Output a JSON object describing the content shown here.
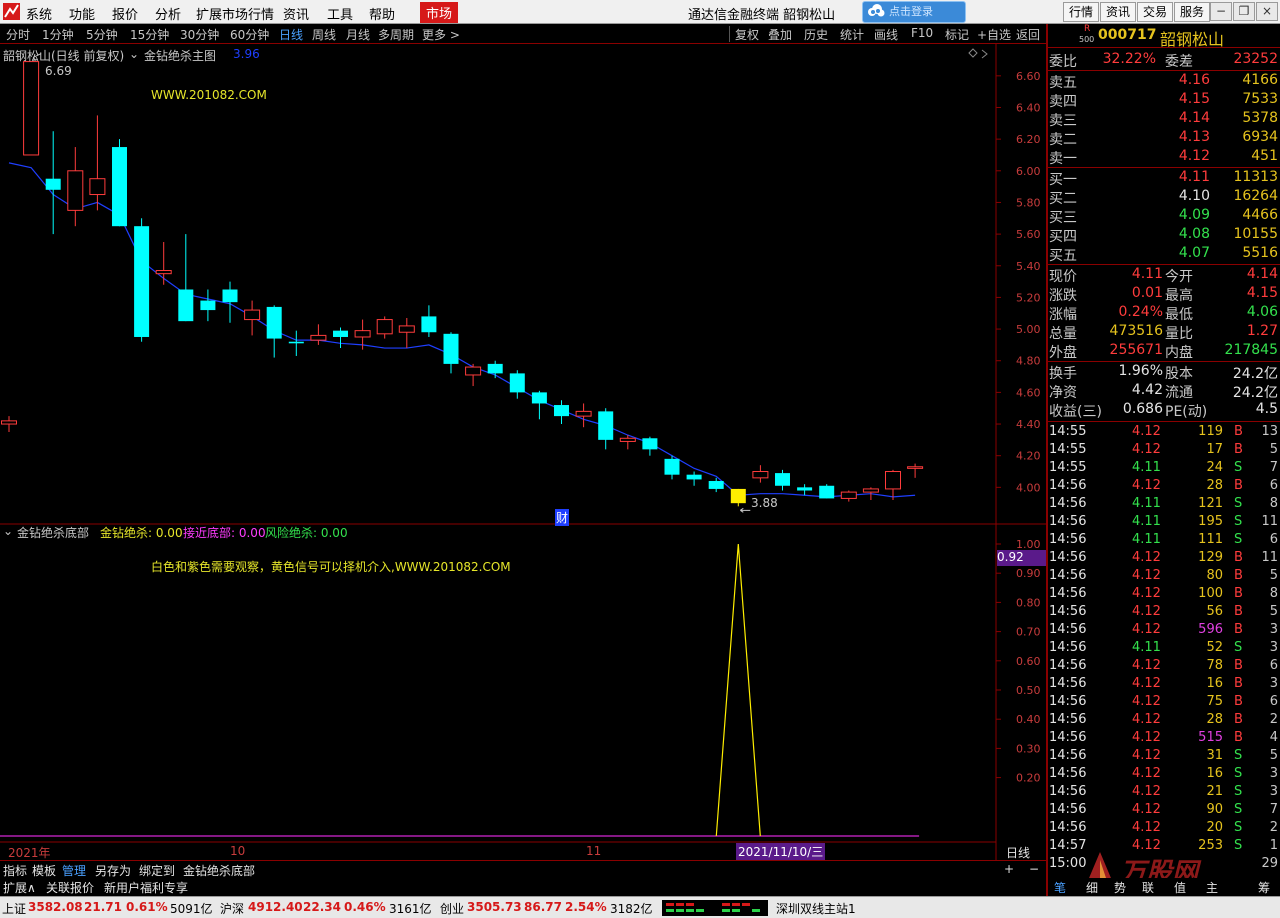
{
  "menubar": {
    "items": [
      "系统",
      "功能",
      "报价",
      "分析",
      "扩展市场行情",
      "资讯",
      "工具",
      "帮助"
    ],
    "market": "市场",
    "title": "通达信金融终端  韶钢松山",
    "login": "点击登录",
    "right_buttons": [
      "行情",
      "资讯",
      "交易",
      "服务"
    ]
  },
  "toolbar": {
    "periods": [
      "分时",
      "1分钟",
      "5分钟",
      "15分钟",
      "30分钟",
      "60分钟",
      "日线",
      "周线",
      "月线",
      "多周期",
      "更多 >"
    ],
    "active": "日线",
    "right": [
      "复权",
      "叠加",
      "历史",
      "统计",
      "画线",
      "F10",
      "标记",
      "+自选",
      "返回"
    ]
  },
  "main_chart": {
    "caption": "韶钢松山(日线 前复权)",
    "indicator": "金钻绝杀主图",
    "indicator_value": "3.96",
    "watermark": "WWW.201082.COM",
    "high_mark": "6.69",
    "low_mark": "3.88",
    "fin_marker": "财",
    "y_labels": [
      "6.60",
      "6.40",
      "6.20",
      "6.00",
      "5.80",
      "5.60",
      "5.40",
      "5.20",
      "5.00",
      "4.80",
      "4.60",
      "4.40",
      "4.20",
      "4.00"
    ],
    "colors": {
      "up": "#ff3c3c",
      "down": "#00ffff",
      "ma": "#1f3fff",
      "signal": "#ffee00"
    }
  },
  "chart_data": {
    "type": "candlestick",
    "ylim": [
      3.8,
      6.7
    ],
    "ohlc": [
      [
        4.4,
        4.45,
        4.35,
        4.42
      ],
      [
        6.1,
        6.69,
        6.2,
        6.69
      ],
      [
        5.95,
        6.25,
        5.6,
        5.88
      ],
      [
        5.75,
        6.15,
        5.65,
        6.0
      ],
      [
        5.85,
        6.35,
        5.75,
        5.95
      ],
      [
        6.15,
        6.2,
        5.65,
        5.65
      ],
      [
        5.65,
        5.7,
        4.92,
        4.95
      ],
      [
        5.35,
        5.55,
        5.28,
        5.37
      ],
      [
        5.25,
        5.6,
        5.05,
        5.05
      ],
      [
        5.18,
        5.25,
        5.05,
        5.12
      ],
      [
        5.25,
        5.3,
        5.04,
        5.17
      ],
      [
        5.06,
        5.18,
        4.96,
        5.12
      ],
      [
        5.14,
        5.15,
        4.82,
        4.94
      ],
      [
        4.92,
        4.99,
        4.83,
        4.91
      ],
      [
        4.93,
        5.03,
        4.9,
        4.96
      ],
      [
        4.99,
        5.01,
        4.88,
        4.95
      ],
      [
        4.95,
        5.06,
        4.87,
        4.99
      ],
      [
        4.97,
        5.08,
        4.94,
        5.06
      ],
      [
        4.98,
        5.07,
        4.88,
        5.02
      ],
      [
        5.08,
        5.15,
        4.95,
        4.98
      ],
      [
        4.97,
        4.98,
        4.72,
        4.78
      ],
      [
        4.71,
        4.78,
        4.64,
        4.76
      ],
      [
        4.78,
        4.8,
        4.69,
        4.72
      ],
      [
        4.72,
        4.74,
        4.56,
        4.6
      ],
      [
        4.6,
        4.61,
        4.43,
        4.53
      ],
      [
        4.52,
        4.55,
        4.4,
        4.45
      ],
      [
        4.45,
        4.53,
        4.38,
        4.48
      ],
      [
        4.48,
        4.5,
        4.24,
        4.3
      ],
      [
        4.29,
        4.33,
        4.24,
        4.31
      ],
      [
        4.31,
        4.32,
        4.2,
        4.24
      ],
      [
        4.18,
        4.2,
        4.05,
        4.08
      ],
      [
        4.08,
        4.1,
        4.01,
        4.05
      ],
      [
        4.04,
        4.06,
        3.97,
        3.99
      ],
      [
        3.9,
        3.99,
        3.88,
        3.99
      ],
      [
        4.06,
        4.14,
        4.03,
        4.1
      ],
      [
        4.09,
        4.11,
        3.98,
        4.01
      ],
      [
        4.0,
        4.02,
        3.95,
        3.98
      ],
      [
        4.01,
        4.02,
        3.93,
        3.93
      ],
      [
        3.93,
        3.98,
        3.91,
        3.97
      ],
      [
        3.97,
        4.0,
        3.92,
        3.99
      ],
      [
        3.99,
        4.11,
        3.92,
        4.1
      ],
      [
        4.12,
        4.15,
        4.06,
        4.13
      ]
    ],
    "ma": [
      6.05,
      6.02,
      5.85,
      5.76,
      5.8,
      5.72,
      5.43,
      5.32,
      5.22,
      5.19,
      5.16,
      5.08,
      4.99,
      4.93,
      4.93,
      4.91,
      4.9,
      4.88,
      4.88,
      4.9,
      4.84,
      4.76,
      4.71,
      4.63,
      4.55,
      4.49,
      4.43,
      4.39,
      4.33,
      4.28,
      4.2,
      4.12,
      4.07,
      3.95,
      3.96,
      3.96,
      3.95,
      3.94,
      3.95,
      3.96,
      3.94,
      3.95
    ]
  },
  "sub_chart": {
    "caption": "金钻绝杀底部",
    "v1_label": "金钻绝杀: 0.00",
    "v2_label": "接近底部: 0.00",
    "v3_label": "风险绝杀: 0.00",
    "note": "白色和紫色需要观察，黄色信号可以择机介入,WWW.201082.COM",
    "y_labels": [
      "1.00",
      "0.90",
      "0.80",
      "0.70",
      "0.60",
      "0.50",
      "0.40",
      "0.30",
      "0.20"
    ],
    "current": "0.92",
    "signal_value": 1.0
  },
  "x_axis": {
    "labels": [
      "2021年",
      "10",
      "11"
    ],
    "cursor": "2021/11/10/三"
  },
  "bottom_bar1": {
    "tabs": [
      "指标",
      "模板",
      "管理",
      "另存为",
      "绑定到",
      "金钻绝杀底部"
    ],
    "active": "管理",
    "period": "日线",
    "plus": "+",
    "minus": "−"
  },
  "bottom_bar2": {
    "tabs": [
      "扩展∧",
      "关联报价",
      "新用户福利专享"
    ]
  },
  "quote": {
    "badge_top": "R",
    "badge_bottom": "500",
    "code": "000717",
    "name": "韶钢松山",
    "wb_label": "委比",
    "wb": "32.22%",
    "wc_label": "委差",
    "wc": "23252",
    "sells": [
      {
        "label": "卖五",
        "price": "4.16",
        "vol": "4166"
      },
      {
        "label": "卖四",
        "price": "4.15",
        "vol": "7533"
      },
      {
        "label": "卖三",
        "price": "4.14",
        "vol": "5378"
      },
      {
        "label": "卖二",
        "price": "4.13",
        "vol": "6934"
      },
      {
        "label": "卖一",
        "price": "4.12",
        "vol": "451"
      }
    ],
    "buys": [
      {
        "label": "买一",
        "price": "4.11",
        "vol": "11313"
      },
      {
        "label": "买二",
        "price": "4.10",
        "vol": "16264"
      },
      {
        "label": "买三",
        "price": "4.09",
        "vol": "4466"
      },
      {
        "label": "买四",
        "price": "4.08",
        "vol": "10155"
      },
      {
        "label": "买五",
        "price": "4.07",
        "vol": "5516"
      }
    ],
    "stats": [
      {
        "l1": "现价",
        "v1": "4.11",
        "l2": "今开",
        "v2": "4.14",
        "c1": "#ff3c3c",
        "c2": "#ff3c3c"
      },
      {
        "l1": "涨跌",
        "v1": "0.01",
        "l2": "最高",
        "v2": "4.15",
        "c1": "#ff3c3c",
        "c2": "#ff3c3c"
      },
      {
        "l1": "涨幅",
        "v1": "0.24%",
        "l2": "最低",
        "v2": "4.06",
        "c1": "#ff3c3c",
        "c2": "#33e14d"
      },
      {
        "l1": "总量",
        "v1": "473516",
        "l2": "量比",
        "v2": "1.27",
        "c1": "#e6c31e",
        "c2": "#ff3c3c"
      },
      {
        "l1": "外盘",
        "v1": "255671",
        "l2": "内盘",
        "v2": "217845",
        "c1": "#ff3c3c",
        "c2": "#33e14d"
      }
    ],
    "stats2": [
      {
        "l1": "换手",
        "v1": "1.96%",
        "l2": "股本",
        "v2": "24.2亿"
      },
      {
        "l1": "净资",
        "v1": "4.42",
        "l2": "流通",
        "v2": "24.2亿"
      },
      {
        "l1": "收益(三)",
        "v1": "0.686",
        "l2": "PE(动)",
        "v2": "4.5"
      }
    ]
  },
  "ticks": [
    {
      "t": "14:55",
      "p": "4.12",
      "v": "119",
      "s": "B",
      "n": "13"
    },
    {
      "t": "14:55",
      "p": "4.12",
      "v": "17",
      "s": "B",
      "n": "5"
    },
    {
      "t": "14:55",
      "p": "4.11",
      "v": "24",
      "s": "S",
      "n": "7"
    },
    {
      "t": "14:56",
      "p": "4.12",
      "v": "28",
      "s": "B",
      "n": "6"
    },
    {
      "t": "14:56",
      "p": "4.11",
      "v": "121",
      "s": "S",
      "n": "8"
    },
    {
      "t": "14:56",
      "p": "4.11",
      "v": "195",
      "s": "S",
      "n": "11"
    },
    {
      "t": "14:56",
      "p": "4.11",
      "v": "111",
      "s": "S",
      "n": "6"
    },
    {
      "t": "14:56",
      "p": "4.12",
      "v": "129",
      "s": "B",
      "n": "11"
    },
    {
      "t": "14:56",
      "p": "4.12",
      "v": "80",
      "s": "B",
      "n": "5"
    },
    {
      "t": "14:56",
      "p": "4.12",
      "v": "100",
      "s": "B",
      "n": "8"
    },
    {
      "t": "14:56",
      "p": "4.12",
      "v": "56",
      "s": "B",
      "n": "5"
    },
    {
      "t": "14:56",
      "p": "4.12",
      "v": "596",
      "s": "B",
      "n": "3"
    },
    {
      "t": "14:56",
      "p": "4.11",
      "v": "52",
      "s": "S",
      "n": "3"
    },
    {
      "t": "14:56",
      "p": "4.12",
      "v": "78",
      "s": "B",
      "n": "6"
    },
    {
      "t": "14:56",
      "p": "4.12",
      "v": "16",
      "s": "B",
      "n": "3"
    },
    {
      "t": "14:56",
      "p": "4.12",
      "v": "75",
      "s": "B",
      "n": "6"
    },
    {
      "t": "14:56",
      "p": "4.12",
      "v": "28",
      "s": "B",
      "n": "2"
    },
    {
      "t": "14:56",
      "p": "4.12",
      "v": "515",
      "s": "B",
      "n": "4"
    },
    {
      "t": "14:56",
      "p": "4.12",
      "v": "31",
      "s": "S",
      "n": "5"
    },
    {
      "t": "14:56",
      "p": "4.12",
      "v": "16",
      "s": "S",
      "n": "3"
    },
    {
      "t": "14:56",
      "p": "4.12",
      "v": "21",
      "s": "S",
      "n": "3"
    },
    {
      "t": "14:56",
      "p": "4.12",
      "v": "90",
      "s": "S",
      "n": "7"
    },
    {
      "t": "14:56",
      "p": "4.12",
      "v": "20",
      "s": "S",
      "n": "2"
    },
    {
      "t": "14:57",
      "p": "4.12",
      "v": "253",
      "s": "S",
      "n": "1"
    },
    {
      "t": "15:00",
      "p": "",
      "v": "",
      "s": "",
      "n": "29"
    }
  ],
  "right_tabs": [
    "笔",
    "细",
    "势",
    "联",
    "值",
    "主",
    "筹"
  ],
  "watermark_brand": "万股网",
  "watermark_url": "www.201082.com",
  "status": {
    "items": [
      {
        "name": "上证",
        "val": "3582.08",
        "chg": "21.71",
        "pct": "0.61%",
        "amt": "5091亿"
      },
      {
        "name": "沪深",
        "val": "4912.40",
        "chg": "22.34",
        "pct": "0.46%",
        "amt": "3161亿"
      },
      {
        "name": "创业",
        "val": "3505.73",
        "chg": "86.77",
        "pct": "2.54%",
        "amt": "3182亿"
      }
    ],
    "server": "深圳双线主站1"
  }
}
